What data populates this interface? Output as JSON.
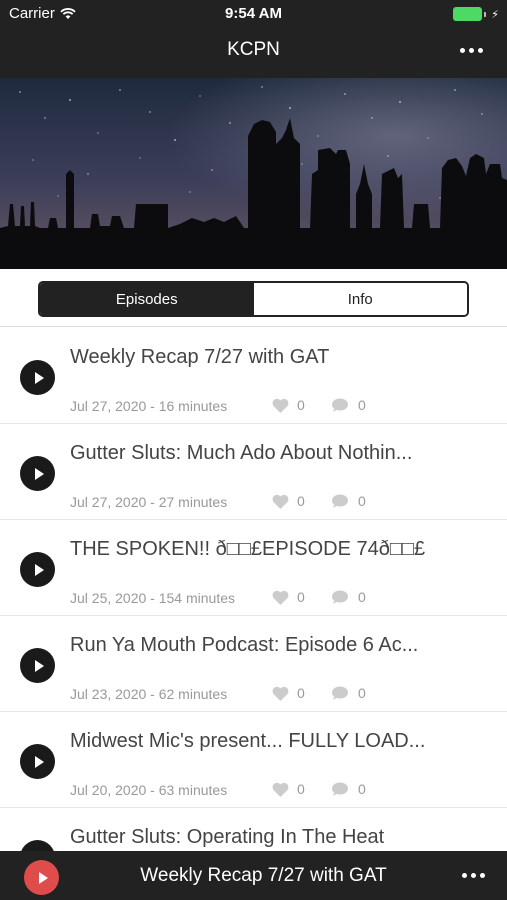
{
  "status_bar": {
    "carrier": "Carrier",
    "time": "9:54 AM"
  },
  "nav": {
    "title": "KCPN",
    "menu_icon": "more-dots-icon"
  },
  "tabs": [
    {
      "label": "Episodes",
      "active": true
    },
    {
      "label": "Info",
      "active": false
    }
  ],
  "episodes": [
    {
      "title": "Weekly Recap 7/27 with GAT",
      "meta": "Jul 27, 2020 - 16 minutes",
      "likes": "0",
      "comments": "0"
    },
    {
      "title": "Gutter Sluts: Much Ado About Nothin...",
      "meta": "Jul 27, 2020 - 27 minutes",
      "likes": "0",
      "comments": "0"
    },
    {
      "title": "THE SPOKEN!! ð□□£EPISODE 74ð□□£",
      "meta": "Jul 25, 2020 - 154 minutes",
      "likes": "0",
      "comments": "0"
    },
    {
      "title": "Run Ya Mouth Podcast: Episode 6  Ac...",
      "meta": "Jul 23, 2020 - 62 minutes",
      "likes": "0",
      "comments": "0"
    },
    {
      "title": "Midwest Mic's present... FULLY LOAD...",
      "meta": "Jul 20, 2020 - 63 minutes",
      "likes": "0",
      "comments": "0"
    },
    {
      "title": "Gutter Sluts: Operating In The Heat",
      "meta": "",
      "likes": "",
      "comments": ""
    }
  ],
  "player": {
    "now_playing": "Weekly Recap 7/27 with GAT"
  },
  "colors": {
    "bar": "#222222",
    "accent_play": "#e04b4b",
    "battery": "#4cd964"
  }
}
